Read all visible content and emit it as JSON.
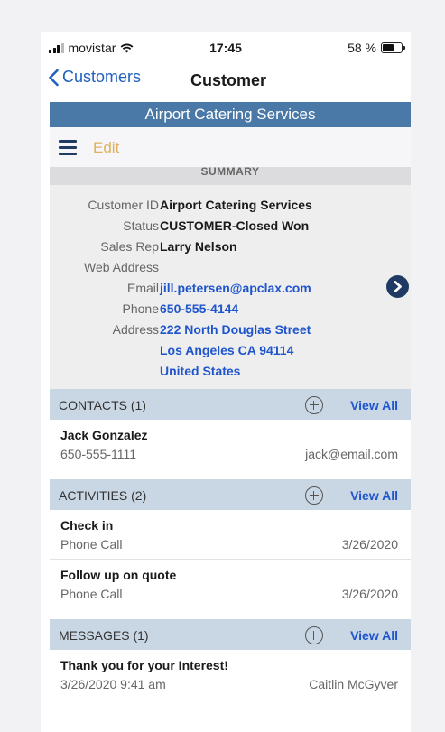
{
  "status_bar": {
    "carrier": "movistar",
    "time": "17:45",
    "battery": "58 %",
    "battery_level": 0.58
  },
  "nav": {
    "back_label": "Customers",
    "title": "Customer"
  },
  "banner": {
    "company": "Airport Catering Services"
  },
  "toolbar": {
    "edit_label": "Edit"
  },
  "summary": {
    "header": "SUMMARY",
    "fields": [
      {
        "label": "Customer ID",
        "value": "Airport Catering Services"
      },
      {
        "label": "Status",
        "value": "CUSTOMER-Closed Won"
      },
      {
        "label": "Sales Rep",
        "value": "Larry Nelson"
      },
      {
        "label": "Web Address",
        "value": ""
      },
      {
        "label": "Email",
        "value": "jill.petersen@apclax.com"
      },
      {
        "label": "Phone",
        "value": "650-555-4144"
      },
      {
        "label": "Address",
        "value": "222 North Douglas Street",
        "line2": "Los Angeles CA 94114",
        "line3": "United States"
      }
    ]
  },
  "contacts": {
    "header": "CONTACTS (1)",
    "view_all": "View All",
    "items": [
      {
        "name": "Jack Gonzalez",
        "phone": "650-555-1111",
        "email": "jack@email.com"
      }
    ]
  },
  "activities": {
    "header": "ACTIVITIES (2)",
    "view_all": "View All",
    "items": [
      {
        "title": "Check in",
        "type": "Phone Call",
        "date": "3/26/2020"
      },
      {
        "title": "Follow up on quote",
        "type": "Phone Call",
        "date": "3/26/2020"
      }
    ]
  },
  "messages": {
    "header": "MESSAGES (1)",
    "view_all": "View All",
    "items": [
      {
        "subject": "Thank you for your Interest!",
        "datetime": "3/26/2020 9:41 am",
        "from": "Caitlin McGyver"
      }
    ]
  },
  "colors": {
    "accent": "#1f55cc",
    "banner": "#4a78a7",
    "section_header": "#c9d6e3",
    "edit": "#e0b060",
    "nav_dark": "#1f3b63"
  }
}
